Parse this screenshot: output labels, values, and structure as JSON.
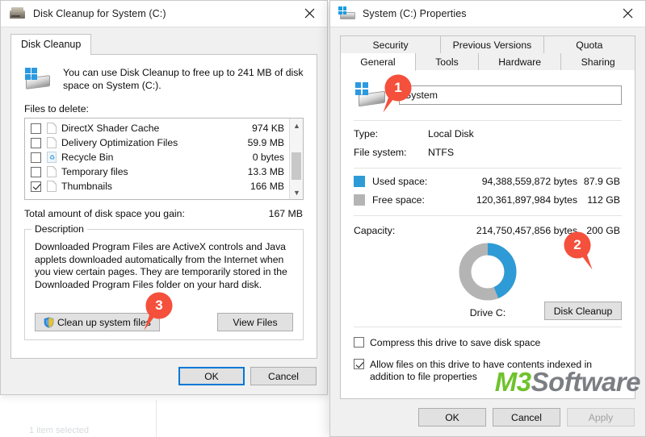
{
  "cleanup_window": {
    "title": "Disk Cleanup for System (C:)",
    "icon": "disk-drive-icon",
    "close_icon": "close-icon",
    "tab_label": "Disk Cleanup",
    "intro_text": "You can use Disk Cleanup to free up to 241 MB of disk space on System (C:).",
    "files_to_delete_label": "Files to delete:",
    "file_items": [
      {
        "name": "DirectX Shader Cache",
        "size": "974 KB",
        "checked": false,
        "icon": "file-icon"
      },
      {
        "name": "Delivery Optimization Files",
        "size": "59.9 MB",
        "checked": false,
        "icon": "file-icon"
      },
      {
        "name": "Recycle Bin",
        "size": "0 bytes",
        "checked": false,
        "icon": "recycle-bin-icon"
      },
      {
        "name": "Temporary files",
        "size": "13.3 MB",
        "checked": false,
        "icon": "file-icon"
      },
      {
        "name": "Thumbnails",
        "size": "166 MB",
        "checked": true,
        "icon": "file-icon"
      }
    ],
    "total_label": "Total amount of disk space you gain:",
    "total_value": "167 MB",
    "description_legend": "Description",
    "description_text": "Downloaded Program Files are ActiveX controls and Java applets downloaded automatically from the Internet when you view certain pages. They are temporarily stored in the Downloaded Program Files folder on your hard disk.",
    "clean_up_system_files_label": "Clean up system files",
    "view_files_label": "View Files",
    "ok_label": "OK",
    "cancel_label": "Cancel"
  },
  "properties_window": {
    "title": "System (C:) Properties",
    "icon": "windows-drive-icon",
    "close_icon": "close-icon",
    "tabs_top": [
      {
        "label": "Security",
        "active": false
      },
      {
        "label": "Previous Versions",
        "active": false
      },
      {
        "label": "Quota",
        "active": false
      }
    ],
    "tabs_bottom": [
      {
        "label": "General",
        "active": true
      },
      {
        "label": "Tools",
        "active": false
      },
      {
        "label": "Hardware",
        "active": false
      },
      {
        "label": "Sharing",
        "active": false
      }
    ],
    "volume_name": "System",
    "type_label": "Type:",
    "type_value": "Local Disk",
    "filesystem_label": "File system:",
    "filesystem_value": "NTFS",
    "used_space_label": "Used space:",
    "used_space_bytes": "94,388,559,872 bytes",
    "used_space_gb": "87.9 GB",
    "free_space_label": "Free space:",
    "free_space_bytes": "120,361,897,984 bytes",
    "free_space_gb": "112 GB",
    "capacity_label": "Capacity:",
    "capacity_bytes": "214,750,457,856 bytes",
    "capacity_gb": "200 GB",
    "drive_label": "Drive C:",
    "disk_cleanup_button": "Disk Cleanup",
    "compress_label": "Compress this drive to save disk space",
    "compress_checked": false,
    "index_label": "Allow files on this drive to have contents indexed in addition to file properties",
    "index_checked": true,
    "ok_label": "OK",
    "cancel_label": "Cancel",
    "apply_label": "Apply"
  },
  "chart_data": {
    "type": "pie",
    "title": "Drive C:",
    "categories": [
      "Used space",
      "Free space"
    ],
    "values": [
      87.9,
      112
    ],
    "unit": "GB",
    "colors": [
      "#2e9bd6",
      "#b4b4b4"
    ],
    "legend": "inline-swatches"
  },
  "callouts": [
    {
      "number": "1"
    },
    {
      "number": "2"
    },
    {
      "number": "3"
    }
  ],
  "watermark": {
    "part1": "M3",
    "part2": "Software",
    "color1": "#6fc22c",
    "color2": "#7b7f84"
  },
  "colors": {
    "accent_blue": "#0078d7",
    "used_space": "#2e9bd6",
    "free_space": "#b4b4b4",
    "pin_red": "#f4503c"
  }
}
